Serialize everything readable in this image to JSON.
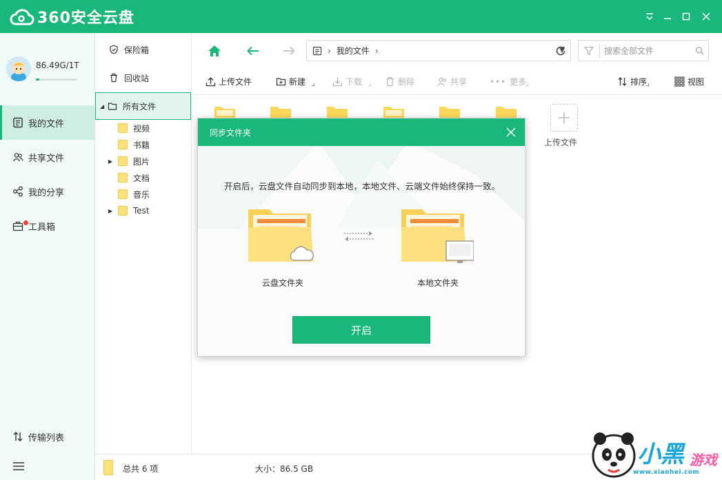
{
  "app": {
    "title": "360安全云盘",
    "window_controls": [
      "dropdown-icon",
      "minimize-icon",
      "maximize-icon",
      "close-icon"
    ]
  },
  "user": {
    "quota": "86.49G/1T",
    "quota_used_fraction": 0.08
  },
  "nav": {
    "items": [
      {
        "label": "我的文件",
        "icon": "my-files-icon",
        "active": true
      },
      {
        "label": "共享文件",
        "icon": "shared-files-icon"
      },
      {
        "label": "我的分享",
        "icon": "share-icon"
      },
      {
        "label": "工具箱",
        "icon": "toolbox-icon"
      }
    ],
    "transfer": "传输列表",
    "menu_icon": "hamburger-icon"
  },
  "tree": {
    "safe": "保险箱",
    "recycle": "回收站",
    "all_files": "所有文件",
    "children": [
      "视频",
      "书籍",
      "图片",
      "文档",
      "音乐",
      "Test"
    ]
  },
  "addr": {
    "breadcrumb": "我的文件",
    "search_placeholder": "搜索全部文件"
  },
  "toolbar": {
    "upload": "上传文件",
    "new": "新建",
    "download": "下载",
    "delete": "删除",
    "share": "共享",
    "more": "更多",
    "sort": "排序",
    "view": "视图"
  },
  "files": {
    "upload_label": "上传文件"
  },
  "status": {
    "total": "总共 6 项",
    "size": "大小：86.5 GB"
  },
  "dialog": {
    "title": "同步文件夹",
    "description": "开启后，云盘文件自动同步到本地，本地文件、云端文件始终保持一致。",
    "cloud_label": "云盘文件夹",
    "local_label": "本地文件夹",
    "button": "开启"
  },
  "watermark": {
    "url": "www.xiaohei.com"
  },
  "colors": {
    "brand": "#19b87a",
    "nav_bg": "#f0faf6",
    "folder": "#fde27a"
  }
}
